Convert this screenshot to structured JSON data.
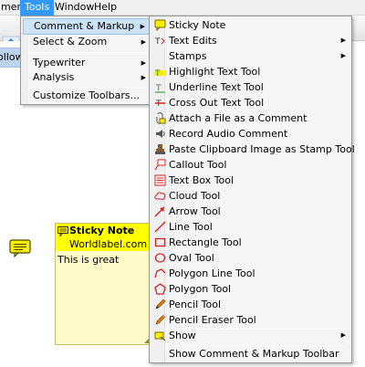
{
  "menubar": {
    "items": [
      {
        "label": "ment"
      },
      {
        "label": "Tools"
      },
      {
        "label": "Window"
      },
      {
        "label": "Help"
      }
    ]
  },
  "side_strip": {
    "label": "ollow"
  },
  "tools_menu": {
    "items": [
      {
        "label": "Comment & Markup",
        "submenu": true,
        "highlighted": true
      },
      {
        "label": "Select & Zoom",
        "submenu": true
      },
      {
        "label": "Typewriter",
        "submenu": true
      },
      {
        "label": "Analysis",
        "submenu": true
      },
      {
        "label": "Customize Toolbars..."
      }
    ]
  },
  "comment_markup_menu": {
    "items": [
      {
        "label": "Sticky Note",
        "icon": "sticky-note-icon"
      },
      {
        "label": "Text Edits",
        "icon": "text-edits-icon",
        "submenu": true
      },
      {
        "label": "Stamps",
        "icon": "",
        "submenu": true
      },
      {
        "label": "Highlight Text Tool",
        "icon": "highlight-text-icon"
      },
      {
        "label": "Underline Text Tool",
        "icon": "underline-text-icon"
      },
      {
        "label": "Cross Out Text Tool",
        "icon": "cross-out-text-icon"
      },
      {
        "label": "Attach a File as a Comment",
        "icon": "attach-file-icon"
      },
      {
        "label": "Record Audio Comment",
        "icon": "record-audio-icon"
      },
      {
        "label": "Paste Clipboard Image as Stamp Tool",
        "icon": "paste-stamp-icon"
      },
      {
        "label": "Callout Tool",
        "icon": "callout-icon"
      },
      {
        "label": "Text Box Tool",
        "icon": "text-box-icon"
      },
      {
        "label": "Cloud Tool",
        "icon": "cloud-icon"
      },
      {
        "label": "Arrow Tool",
        "icon": "arrow-tool-icon"
      },
      {
        "label": "Line Tool",
        "icon": "line-tool-icon"
      },
      {
        "label": "Rectangle Tool",
        "icon": "rectangle-tool-icon"
      },
      {
        "label": "Oval Tool",
        "icon": "oval-tool-icon"
      },
      {
        "label": "Polygon Line Tool",
        "icon": "polygon-line-icon"
      },
      {
        "label": "Polygon Tool",
        "icon": "polygon-tool-icon"
      },
      {
        "label": "Pencil Tool",
        "icon": "pencil-tool-icon"
      },
      {
        "label": "Pencil Eraser Tool",
        "icon": "pencil-eraser-icon"
      },
      {
        "label": "Show",
        "icon": "show-icon",
        "submenu": true
      },
      {
        "label": "Show Comment & Markup Toolbar",
        "icon": ""
      }
    ]
  },
  "sticky_note": {
    "title": "Sticky Note",
    "author": "Worldlabel.com",
    "body": "This is great"
  },
  "colors": {
    "menu_highlight": "#cde3f8",
    "menubar_active": "#3399ff",
    "note_header": "#ffff00",
    "note_body": "#fffbc8",
    "icon_red": "#d42020",
    "icon_orange": "#e07a00",
    "icon_green": "#2a8a2a"
  }
}
